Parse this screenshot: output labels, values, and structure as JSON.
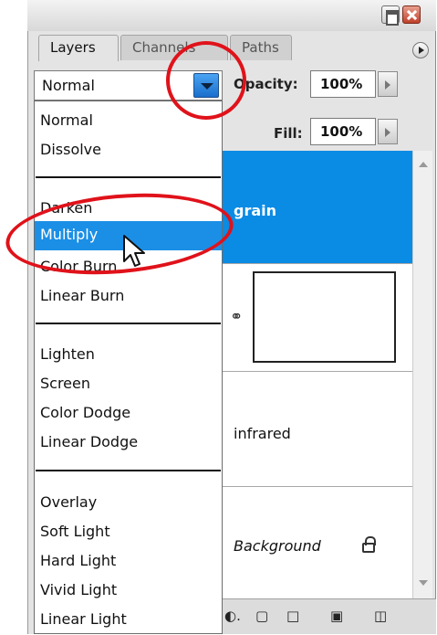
{
  "tabs": [
    {
      "label": "Layers"
    },
    {
      "label": "Channels"
    },
    {
      "label": "Paths"
    }
  ],
  "blend_mode": {
    "value": "Normal"
  },
  "opacity": {
    "label": "Opacity:",
    "value": "100%"
  },
  "fill": {
    "label": "Fill:",
    "value": "100%"
  },
  "dropdown": {
    "group1": [
      "Normal",
      "Dissolve"
    ],
    "group2": [
      "Darken",
      "Multiply",
      "Color Burn",
      "Linear Burn"
    ],
    "group3": [
      "Lighten",
      "Screen",
      "Color Dodge",
      "Linear Dodge"
    ],
    "group4": [
      "Overlay",
      "Soft Light",
      "Hard Light",
      "Vivid Light",
      "Linear Light"
    ],
    "highlighted": "Multiply"
  },
  "layers": [
    {
      "name": "grain",
      "selected": true
    },
    {
      "name": "",
      "has_mask": true
    },
    {
      "name": "infrared"
    },
    {
      "name": "Background",
      "locked": true
    }
  ],
  "icons": [
    "minimize-icon",
    "close-icon",
    "panel-menu-icon",
    "dropdown-arrow-icon",
    "chain-link-icon",
    "lock-icon",
    "adjustment-layer-icon",
    "folder-icon",
    "new-layer-icon",
    "trash-icon",
    "cursor-icon"
  ],
  "colors": {
    "selection": "#0a8be4",
    "highlight": "#1b8fe6",
    "annotation": "#e0121a"
  }
}
